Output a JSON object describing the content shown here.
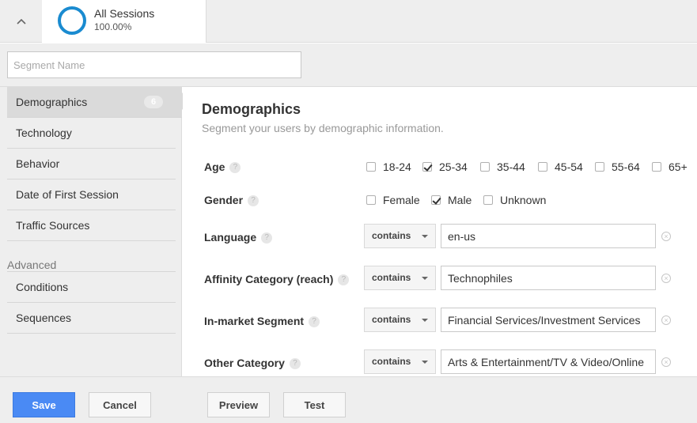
{
  "header": {
    "segment_title": "All Sessions",
    "segment_percent": "100.00%"
  },
  "segment_name": {
    "placeholder": "Segment Name",
    "value": ""
  },
  "sidebar": {
    "items": [
      {
        "label": "Demographics",
        "badge": "6",
        "active": true
      },
      {
        "label": "Technology"
      },
      {
        "label": "Behavior"
      },
      {
        "label": "Date of First Session"
      },
      {
        "label": "Traffic Sources"
      }
    ],
    "advanced_label": "Advanced",
    "advanced_items": [
      {
        "label": "Conditions"
      },
      {
        "label": "Sequences"
      }
    ]
  },
  "main": {
    "title": "Demographics",
    "subtitle": "Segment your users by demographic information.",
    "age": {
      "label": "Age",
      "options": [
        {
          "label": "18-24",
          "checked": false
        },
        {
          "label": "25-34",
          "checked": true
        },
        {
          "label": "35-44",
          "checked": false
        },
        {
          "label": "45-54",
          "checked": false
        },
        {
          "label": "55-64",
          "checked": false
        },
        {
          "label": "65+",
          "checked": false
        }
      ]
    },
    "gender": {
      "label": "Gender",
      "options": [
        {
          "label": "Female",
          "checked": false
        },
        {
          "label": "Male",
          "checked": true
        },
        {
          "label": "Unknown",
          "checked": false
        }
      ]
    },
    "conditions": [
      {
        "label": "Language",
        "operator": "contains",
        "value": "en-us"
      },
      {
        "label": "Affinity Category (reach)",
        "operator": "contains",
        "value": "Technophiles"
      },
      {
        "label": "In-market Segment",
        "operator": "contains",
        "value": "Financial Services/Investment Services"
      },
      {
        "label": "Other Category",
        "operator": "contains",
        "value": "Arts & Entertainment/TV & Video/Online"
      }
    ],
    "help_glyph": "?",
    "clear_glyph": "×"
  },
  "footer": {
    "save": "Save",
    "cancel": "Cancel",
    "preview": "Preview",
    "test": "Test"
  },
  "colors": {
    "primary_button": "#4a8af4",
    "ring": "#1a8bd0"
  }
}
